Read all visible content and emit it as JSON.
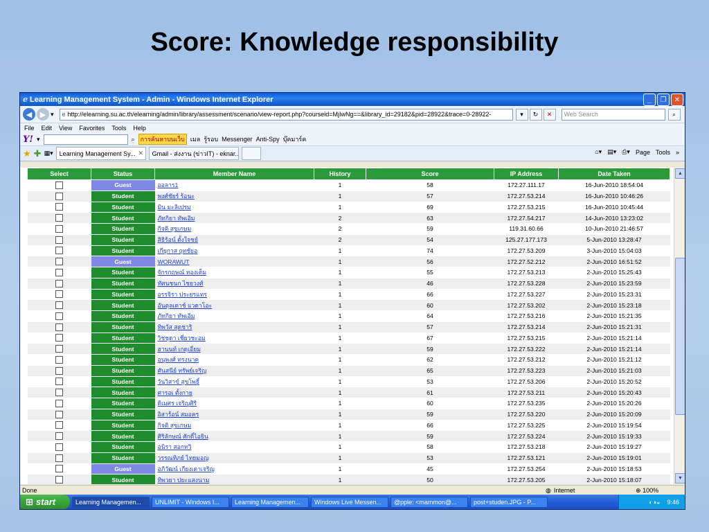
{
  "slide": {
    "title": "Score: Knowledge responsibility"
  },
  "window": {
    "title": "Learning Management System - Admin - Windows Internet Explorer",
    "url": "http://elearning.su.ac.th/elearning/admin/library/assessment/scenario/view-report.php?courseid=MjIwNg==&library_id=29182&pid=28922&trace=0-28922-",
    "search_placeholder": "Web Search",
    "menu": [
      "File",
      "Edit",
      "View",
      "Favorites",
      "Tools",
      "Help"
    ],
    "yahoo_toolbar": {
      "search_btn": "การค้นหาบนเว็บ",
      "mail": "เมล",
      "news": "รู้รอบ",
      "messenger": "Messenger",
      "antispy": "Anti-Spy",
      "bookmarks": "บุ๊คมาร์ค"
    },
    "tabs": [
      {
        "label": "Learning Management Sy..."
      },
      {
        "label": "Gmail - ส่งงาน (ข่าวIT) - eknar..."
      }
    ],
    "tools_right": {
      "page": "Page",
      "tools": "Tools"
    }
  },
  "table": {
    "headers": [
      "Select",
      "Status",
      "Member Name",
      "History",
      "Score",
      "IP Address",
      "Date Taken"
    ],
    "rows": [
      {
        "status": "Guest",
        "name": "ออลาร1",
        "history": "1",
        "score": "58",
        "ip": "172.27.111.17",
        "date": "16-Jun-2010 18:54:04"
      },
      {
        "status": "Student",
        "name": "พงศ์ชัยร์ ร้อนะ",
        "history": "1",
        "score": "57",
        "ip": "172.27.53.214",
        "date": "16-Jun-2010 10:46:26"
      },
      {
        "status": "Student",
        "name": "มิน มะลิเปรม",
        "history": "1",
        "score": "69",
        "ip": "172.27.53.215",
        "date": "16-Jun-2010 10:45:44"
      },
      {
        "status": "Student",
        "name": "ภัทกิยา ทัพเอิม",
        "history": "2",
        "score": "63",
        "ip": "172.27.54.217",
        "date": "14-Jun-2010 13:23:02"
      },
      {
        "status": "Student",
        "name": "กิจติ สุขเกษม",
        "history": "2",
        "score": "59",
        "ip": "119.31.60.66",
        "date": "10-Jun-2010 21:46:57"
      },
      {
        "status": "Student",
        "name": "สิธิร้อน์ ตั้งใจชย์",
        "history": "2",
        "score": "54",
        "ip": "125.27.177.173",
        "date": "5-Jun-2010 13:28:47"
      },
      {
        "status": "Student",
        "name": "เกียุกาส ฤทชัยอ",
        "history": "1",
        "score": "74",
        "ip": "172.27.53.209",
        "date": "3-Jun-2010 15:04:03"
      },
      {
        "status": "Guest",
        "name": "WORAWUT",
        "history": "1",
        "score": "56",
        "ip": "172.27.52.212",
        "date": "2-Jun-2010 16:51:52"
      },
      {
        "status": "Student",
        "name": "จักรกฤษณ์ ทองเต็ม",
        "history": "1",
        "score": "55",
        "ip": "172.27.53.213",
        "date": "2-Jun-2010 15:25:43"
      },
      {
        "status": "Student",
        "name": "ทัศนชนก ไชยวงศ์",
        "history": "1",
        "score": "46",
        "ip": "172.27.53.228",
        "date": "2-Jun-2010 15:23:59"
      },
      {
        "status": "Student",
        "name": "อรรจิรา ประยรแทร",
        "history": "1",
        "score": "66",
        "ip": "172.27.53.227",
        "date": "2-Jun-2010 15:23:31"
      },
      {
        "status": "Student",
        "name": "อันตุลเดาช์ แวดาโอะ",
        "history": "1",
        "score": "60",
        "ip": "172.27.53.202",
        "date": "2-Jun-2010 15:23:18"
      },
      {
        "status": "Student",
        "name": "ภัทกิยา ทัพเอิม",
        "history": "1",
        "score": "64",
        "ip": "172.27.53.216",
        "date": "2-Jun-2010 15:21:35"
      },
      {
        "status": "Student",
        "name": "ทิพวัส สุดชาริ",
        "history": "1",
        "score": "57",
        "ip": "172.27.53.214",
        "date": "2-Jun-2010 15:21:31"
      },
      {
        "status": "Student",
        "name": "วิชชุดา เชี่ยวชะอม",
        "history": "1",
        "score": "67",
        "ip": "172.27.53.215",
        "date": "2-Jun-2010 15:21:14"
      },
      {
        "status": "Student",
        "name": "ฮานนท์ เกดุเอี่ยม",
        "history": "1",
        "score": "59",
        "ip": "172.27.53.222",
        "date": "2-Jun-2010 15:21:14"
      },
      {
        "status": "Student",
        "name": "อนุพงศ์ ทรงนาค",
        "history": "1",
        "score": "62",
        "ip": "172.27.53.212",
        "date": "2-Jun-2010 15:21:12"
      },
      {
        "status": "Student",
        "name": "ศันสนีย์ ทรัพย์เจริญ",
        "history": "1",
        "score": "65",
        "ip": "172.27.53.223",
        "date": "2-Jun-2010 15:21:03"
      },
      {
        "status": "Student",
        "name": "วันวิสาข์ สุขโพธิ์",
        "history": "1",
        "score": "53",
        "ip": "172.27.53.206",
        "date": "2-Jun-2010 15:20:52"
      },
      {
        "status": "Student",
        "name": "ศารอเ ตั้งกาย",
        "history": "1",
        "score": "61",
        "ip": "172.27.53.211",
        "date": "2-Jun-2010 15:20:43"
      },
      {
        "status": "Student",
        "name": "ดิเมศร เจริญศิริ",
        "history": "1",
        "score": "60",
        "ip": "172.27.53.235",
        "date": "2-Jun-2010 15:20:26"
      },
      {
        "status": "Student",
        "name": "อิสาร้อน์ สมอคร",
        "history": "1",
        "score": "59",
        "ip": "172.27.53.220",
        "date": "2-Jun-2010 15:20:09"
      },
      {
        "status": "Student",
        "name": "กิจติ สุขเกษม",
        "history": "1",
        "score": "66",
        "ip": "172.27.53.225",
        "date": "2-Jun-2010 15:19:54"
      },
      {
        "status": "Student",
        "name": "ศิริลักษณ์ ศักดิ์ไอยิน",
        "history": "1",
        "score": "59",
        "ip": "172.27.53.224",
        "date": "2-Jun-2010 15:19:33"
      },
      {
        "status": "Student",
        "name": "อนิรา สอกทวิ",
        "history": "1",
        "score": "58",
        "ip": "172.27.53.218",
        "date": "2-Jun-2010 15:19:27"
      },
      {
        "status": "Student",
        "name": "วรรณทิภย์ ไทยมอญ",
        "history": "1",
        "score": "53",
        "ip": "172.27.53.121",
        "date": "2-Jun-2010 15:19:01"
      },
      {
        "status": "Guest",
        "name": "อภิวัฒน์ เกียงเดาเจริญ",
        "history": "1",
        "score": "45",
        "ip": "172.27.53.254",
        "date": "2-Jun-2010 15:18:53"
      },
      {
        "status": "Student",
        "name": "ทิพวยา ปยะแสงนาม",
        "history": "1",
        "score": "50",
        "ip": "172.27.53.205",
        "date": "2-Jun-2010 15:18:07"
      }
    ]
  },
  "statusbar": {
    "left": "Done",
    "zone": "Internet",
    "zoom": "100%"
  },
  "taskbar": {
    "start": "start",
    "tasks": [
      "Learning Managemen...",
      "UNLIMIT - Windows I...",
      "Learning Managemen...",
      "Windows Live Messen...",
      "@pple: <mammon@...",
      "post+studen.JPG - P..."
    ],
    "clock": "9:46"
  },
  "colors": {
    "header_green": "#2a9a3a",
    "student_green": "#1f8d2e",
    "guest_blue": "#8088e6",
    "link_blue": "#1a3fd0"
  }
}
